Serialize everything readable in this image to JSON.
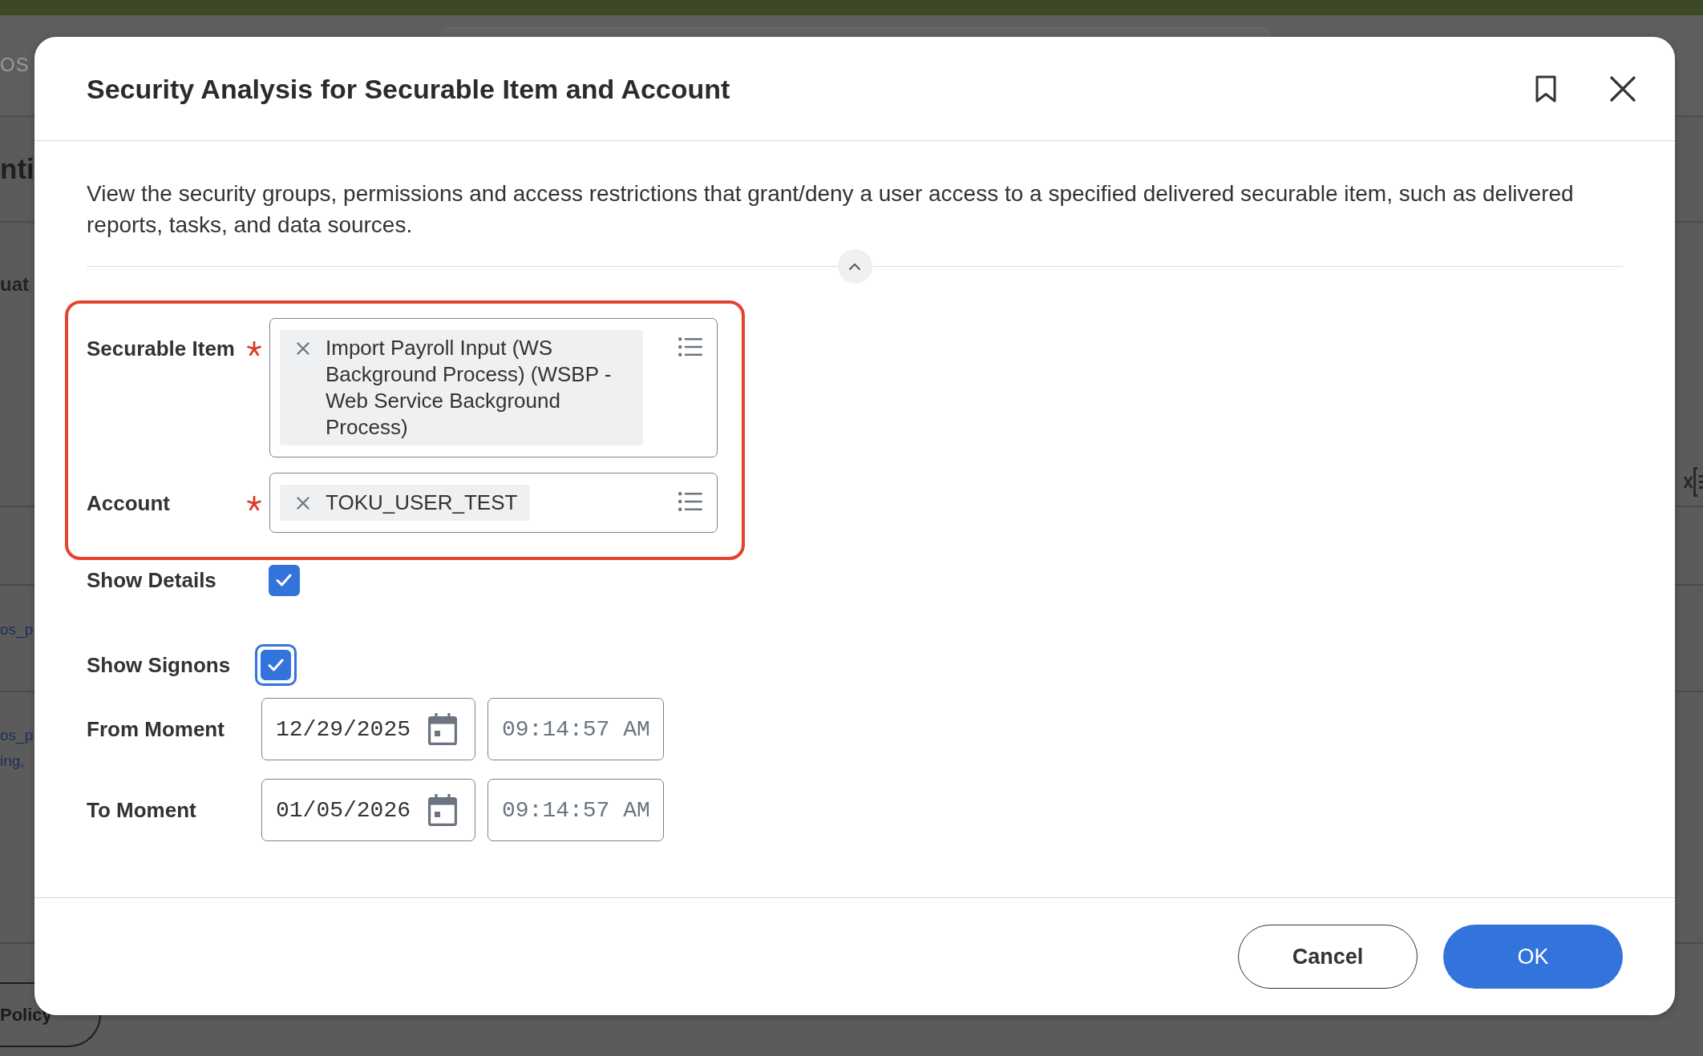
{
  "background_page": {
    "header_label": "OS",
    "title": "nti",
    "section_label": "uat",
    "table_rows": [
      {
        "lines": [
          "os_p"
        ]
      },
      {
        "lines": [
          "os_p",
          "ing,"
        ]
      }
    ],
    "button": "Policy"
  },
  "dialog": {
    "title": "Security Analysis for Securable Item and Account",
    "description": "View the security groups, permissions and access restrictions that grant/deny a user access to a specified delivered securable item, such as delivered reports, tasks, and data sources.",
    "description_expanded": true,
    "highlighted_fields": [
      {
        "label": "Securable Item",
        "required": true,
        "selections": [
          "Import Payroll Input (WS Background Process) (WSBP - Web Service Background Process)"
        ]
      },
      {
        "label": "Account",
        "required": true,
        "selections": [
          "TOKU_USER_TEST"
        ]
      }
    ],
    "checkboxes": [
      {
        "label": "Show Details",
        "checked": true,
        "focused": false
      },
      {
        "label": "Show Signons",
        "checked": true,
        "focused": true
      }
    ],
    "moments": [
      {
        "label": "From Moment",
        "date": "12/29/2025",
        "time": "09:14:57 AM"
      },
      {
        "label": "To Moment",
        "date": "01/05/2026",
        "time": "09:14:57 AM"
      }
    ],
    "buttons": [
      {
        "label": "Cancel",
        "kind": "secondary"
      },
      {
        "label": "OK",
        "kind": "primary"
      }
    ]
  }
}
